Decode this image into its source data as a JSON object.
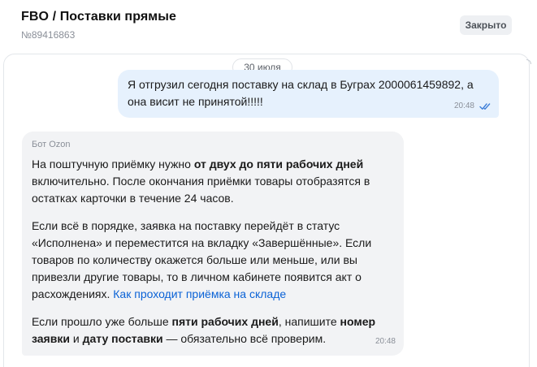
{
  "header": {
    "title": "FBO / Поставки прямые",
    "ticket_no": "№89416863",
    "status": "Закрыто"
  },
  "chat": {
    "date": "30 июля",
    "outgoing": {
      "text": "Я отгрузил сегодня поставку на склад в Буграх 2000061459892, а она висит не принятой!!!!!",
      "time": "20:48",
      "status_icon": "double-check-icon",
      "status_color": "#3d7ed8"
    },
    "incoming": {
      "sender": "Бот Ozon",
      "time": "20:48",
      "p1": {
        "a": "На поштучную приёмку нужно ",
        "b_bold": "от двух до пяти рабочих дней",
        "c": " включительно. После окончания приёмки товары отобразятся в остатках карточки в течение 24 часов."
      },
      "p2": {
        "a": "Если всё в порядке, заявка на поставку перейдёт в статус «Исполнена» и переместится на вкладку «Завершённые». Если товаров по количеству окажется больше или меньше, или вы привезли другие товары, то в личном кабинете появится акт о расхождениях. ",
        "link": "Как проходит приёмка на складе"
      },
      "p3": {
        "a": "Если прошло уже больше ",
        "b_bold": "пяти рабочих дней",
        "c": ", напишите ",
        "d_bold": "номер заявки",
        "e": " и ",
        "f_bold": "дату поставки",
        "g": " — обязательно всё проверим."
      }
    }
  },
  "colors": {
    "outgoing_bg": "#e6f1fd",
    "incoming_bg": "#f2f3f5",
    "link": "#0a62d6"
  }
}
